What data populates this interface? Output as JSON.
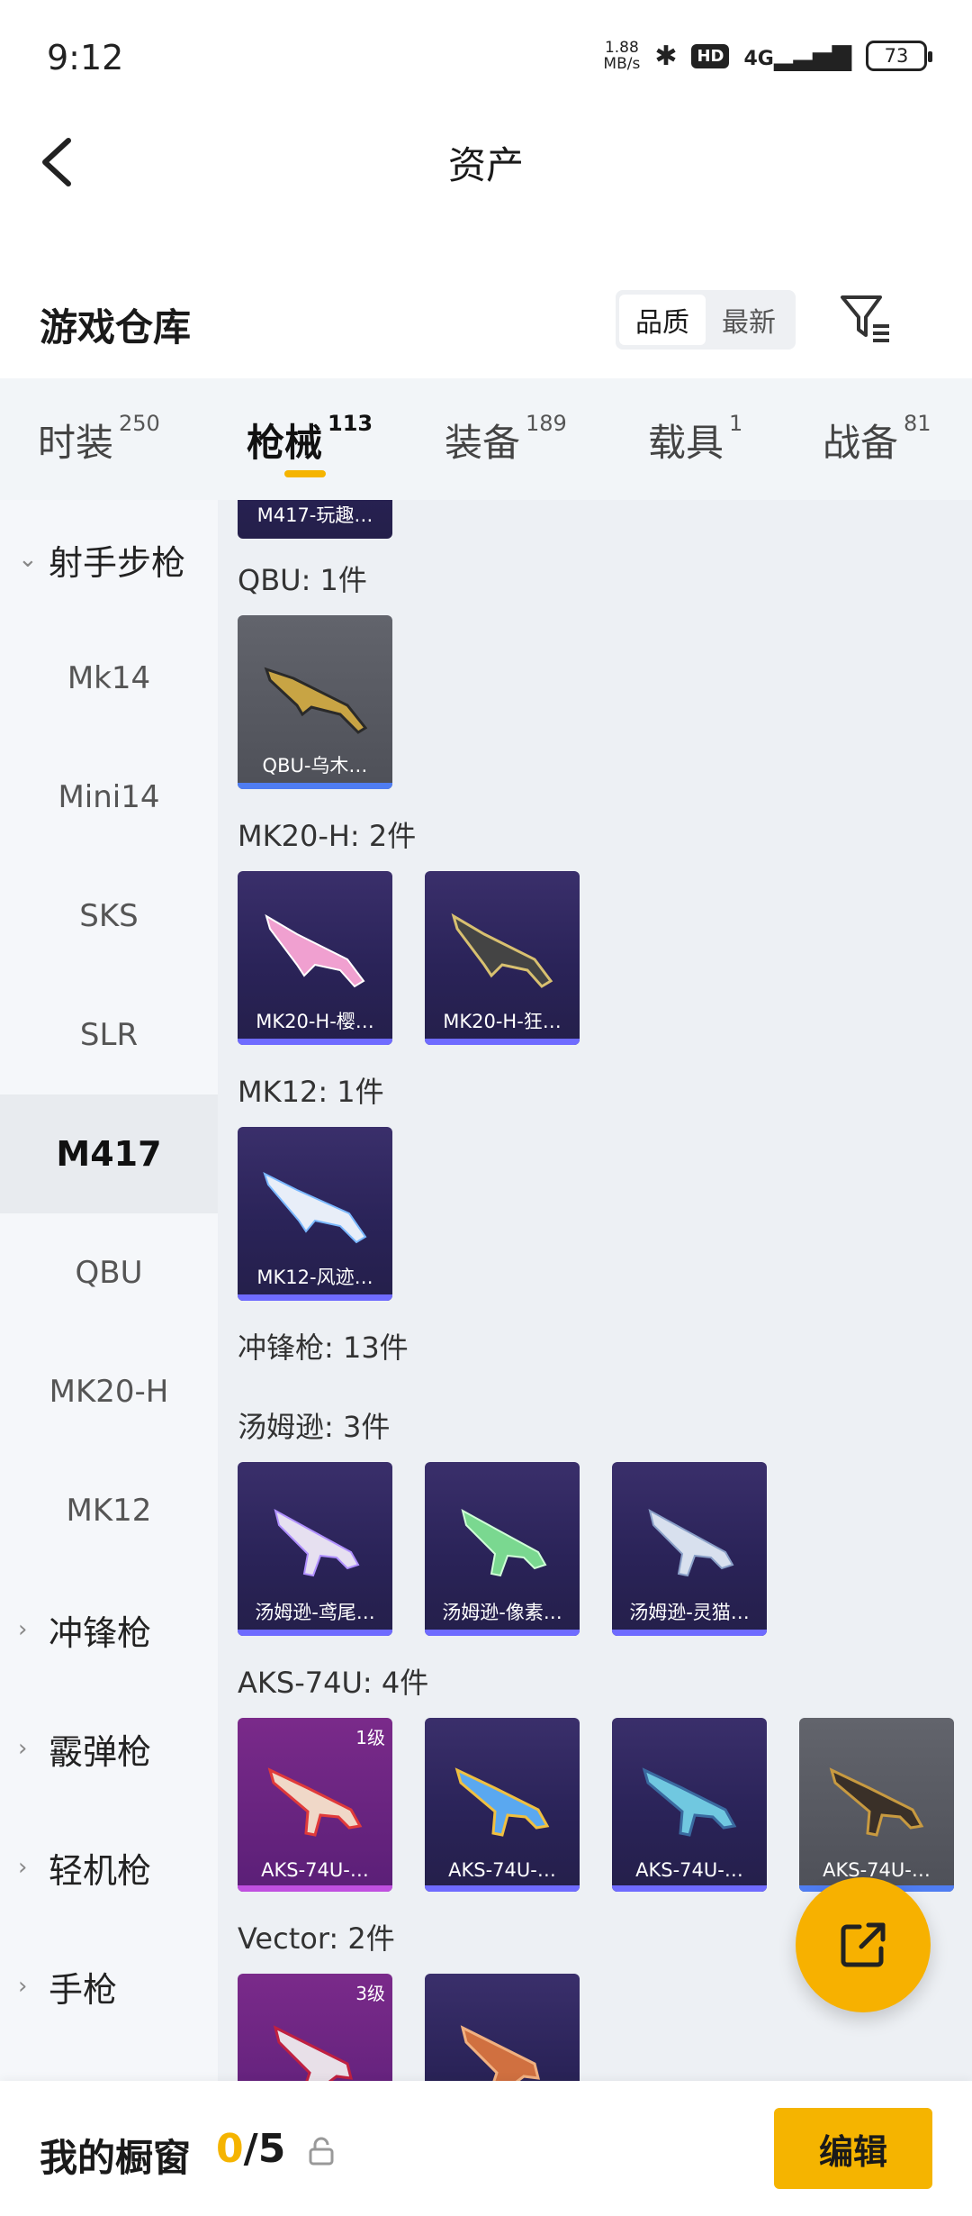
{
  "status_bar": {
    "time": "9:12",
    "net_speed_value": "1.88",
    "net_speed_unit": "MB/s",
    "network": "4G",
    "hd": "HD",
    "battery": "73"
  },
  "header": {
    "title": "资产",
    "back_icon": "chevron-left-icon"
  },
  "section": {
    "title": "游戏仓库",
    "sort_options": [
      "品质",
      "最新"
    ],
    "sort_selected": "品质",
    "filter_icon": "filter-icon"
  },
  "tabs": [
    {
      "label": "时装",
      "count": "250"
    },
    {
      "label": "枪械",
      "count": "113",
      "active": true
    },
    {
      "label": "装备",
      "count": "189"
    },
    {
      "label": "载具",
      "count": "1"
    },
    {
      "label": "战备",
      "count": "81"
    }
  ],
  "sidebar": {
    "items": [
      {
        "label": "射手步枪",
        "type": "group",
        "expanded": true
      },
      {
        "label": "Mk14"
      },
      {
        "label": "Mini14"
      },
      {
        "label": "SKS"
      },
      {
        "label": "SLR"
      },
      {
        "label": "M417",
        "active": true
      },
      {
        "label": "QBU"
      },
      {
        "label": "MK20-H"
      },
      {
        "label": "MK12"
      },
      {
        "label": "冲锋枪",
        "type": "group"
      },
      {
        "label": "霰弹枪",
        "type": "group"
      },
      {
        "label": "轻机枪",
        "type": "group"
      },
      {
        "label": "手枪",
        "type": "group"
      }
    ]
  },
  "content": {
    "partial_card": {
      "name": "M417-玩趣…"
    },
    "groups": [
      {
        "label": "QBU: 1件",
        "cards": [
          {
            "name": "QBU-乌木…",
            "style": "gray"
          }
        ]
      },
      {
        "label": "MK20-H: 2件",
        "cards": [
          {
            "name": "MK20-H-樱…",
            "style": "purple"
          },
          {
            "name": "MK20-H-狂…",
            "style": "purple"
          }
        ]
      },
      {
        "label": "MK12: 1件",
        "cards": [
          {
            "name": "MK12-风迹…",
            "style": "purple"
          }
        ]
      },
      {
        "label": "冲锋枪: 13件",
        "cards": []
      },
      {
        "label": "汤姆逊: 3件",
        "cards": [
          {
            "name": "汤姆逊-鸢尾…",
            "style": "purple"
          },
          {
            "name": "汤姆逊-像素…",
            "style": "purple"
          },
          {
            "name": "汤姆逊-灵猫…",
            "style": "purple"
          }
        ]
      },
      {
        "label": "AKS-74U: 4件",
        "cards": [
          {
            "name": "AKS-74U-…",
            "style": "magenta",
            "badge": "1级"
          },
          {
            "name": "AKS-74U-…",
            "style": "purple"
          },
          {
            "name": "AKS-74U-…",
            "style": "purple"
          },
          {
            "name": "AKS-74U-…",
            "style": "gray"
          }
        ]
      },
      {
        "label": "Vector: 2件",
        "cards": [
          {
            "name": "",
            "style": "magenta",
            "badge": "3级"
          },
          {
            "name": "",
            "style": "purple"
          }
        ]
      }
    ]
  },
  "fab": {
    "icon": "share-external-icon"
  },
  "bottom_bar": {
    "label": "我的橱窗",
    "current": "0",
    "separator_total": "/5",
    "lock_icon": "lock-icon",
    "edit_label": "编辑"
  }
}
